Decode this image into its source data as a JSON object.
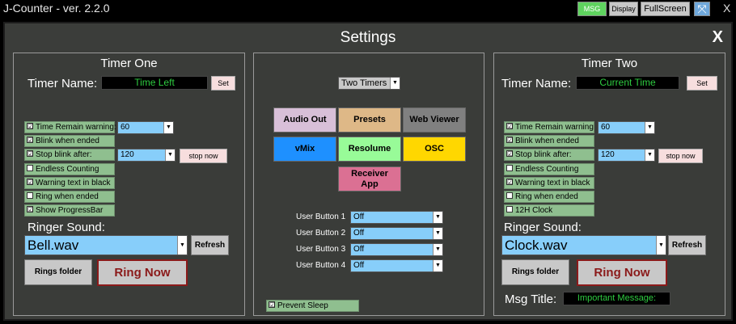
{
  "titlebar": {
    "title": "J-Counter - ver.  2.2.0",
    "msg": "MSG",
    "display": "Display",
    "fullscreen": "FullScreen",
    "expand_glyph": "⤧",
    "close": "X"
  },
  "settings": {
    "title": "Settings",
    "close": "X"
  },
  "timer_one": {
    "title": "Timer One",
    "name_label": "Timer Name:",
    "name_value": "Time Left",
    "set": "Set",
    "checks": [
      {
        "label": "Time Remain warning:",
        "checked": true
      },
      {
        "label": "Blink when ended",
        "checked": true
      },
      {
        "label": "Stop blink after:",
        "checked": true
      },
      {
        "label": "Endless Counting",
        "checked": false
      },
      {
        "label": "Warning text in black",
        "checked": true
      },
      {
        "label": "Ring when ended",
        "checked": false
      },
      {
        "label": "Show ProgressBar",
        "checked": true
      }
    ],
    "warning_value": "60",
    "blink_value": "120",
    "stop_now": "stop now",
    "ringer_label": "Ringer Sound:",
    "ringer_value": "Bell.wav",
    "refresh": "Refresh",
    "rings_folder": "Rings folder",
    "ring_now": "Ring Now"
  },
  "middle": {
    "mode": "Two Timers",
    "buttons": {
      "audio_out": "Audio Out",
      "presets": "Presets",
      "web_viewer": "Web Viewer",
      "vmix": "vMix",
      "resolume": "Resolume",
      "osc": "OSC",
      "receiver_line1": "Receiver",
      "receiver_line2": "App"
    },
    "user_buttons": [
      {
        "label": "User Button 1",
        "value": "Off"
      },
      {
        "label": "User Button 2",
        "value": "Off"
      },
      {
        "label": "User Button 3",
        "value": "Off"
      },
      {
        "label": "User Button 4",
        "value": "Off"
      }
    ],
    "prevent_sleep": "Prevent Sleep",
    "prevent_sleep_checked": true
  },
  "timer_two": {
    "title": "Timer Two",
    "name_label": "Timer Name:",
    "name_value": "Current Time",
    "set": "Set",
    "checks": [
      {
        "label": "Time Remain warning",
        "checked": true
      },
      {
        "label": "Blink when ended",
        "checked": true
      },
      {
        "label": "Stop blink after:",
        "checked": true
      },
      {
        "label": "Endless Counting",
        "checked": false
      },
      {
        "label": "Warning text in black",
        "checked": true
      },
      {
        "label": "Ring when ended",
        "checked": false
      },
      {
        "label": "12H Clock",
        "checked": false
      }
    ],
    "warning_value": "60",
    "blink_value": "120",
    "stop_now": "stop now",
    "ringer_label": "Ringer Sound:",
    "ringer_value": "Clock.wav",
    "refresh": "Refresh",
    "rings_folder": "Rings folder",
    "ring_now": "Ring Now",
    "msg_title_label": "Msg Title:",
    "msg_title_value": "Important Message:"
  },
  "colors": {
    "panel_bg": "#3a3c39",
    "check_green": "#8fbf8f",
    "combo_blue": "#87cefa",
    "audio_out": "#d8bfd8",
    "presets": "#deb887",
    "web_viewer": "#808080",
    "vmix": "#1e90ff",
    "resolume": "#98fb98",
    "osc": "#ffd700",
    "receiver": "#db7093"
  }
}
